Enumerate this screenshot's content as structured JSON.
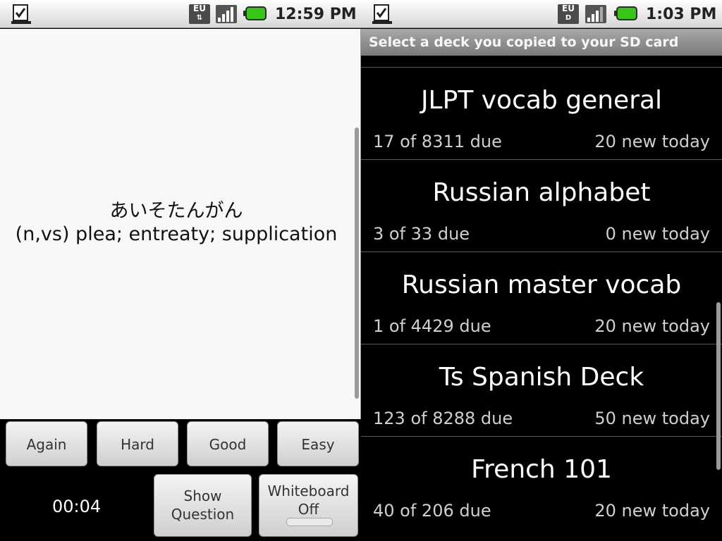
{
  "left": {
    "status": {
      "time": "12:59 PM",
      "network": "EU"
    },
    "card": {
      "front": "あいそたんがん",
      "back": "(n,vs) plea; entreaty; supplication"
    },
    "answer_buttons": {
      "again": "Again",
      "hard": "Hard",
      "good": "Good",
      "easy": "Easy"
    },
    "timer": "00:04",
    "show_question": {
      "line1": "Show",
      "line2": "Question"
    },
    "whiteboard": {
      "line1": "Whiteboard",
      "line2": "Off"
    }
  },
  "right": {
    "status": {
      "time": "1:03 PM",
      "network": "EU"
    },
    "header": "Select a deck you copied to your SD card",
    "decks": [
      {
        "name": "JLPT vocab general",
        "due": "17 of 8311 due",
        "new": "20 new today"
      },
      {
        "name": "Russian alphabet",
        "due": "3 of 33 due",
        "new": "0 new today"
      },
      {
        "name": "Russian master vocab",
        "due": "1 of 4429 due",
        "new": "20 new today"
      },
      {
        "name": "Ts Spanish Deck",
        "due": "123 of 8288 due",
        "new": "50 new today"
      },
      {
        "name": "French 101",
        "due": "40 of 206 due",
        "new": "20 new today"
      }
    ]
  }
}
